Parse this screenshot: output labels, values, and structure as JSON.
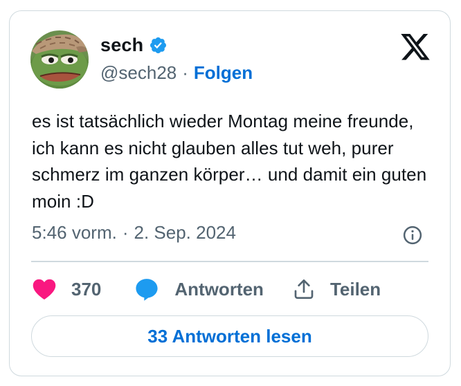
{
  "author": {
    "display_name": "sech",
    "handle": "@sech28",
    "verified": true,
    "avatar": "pepe-frog-with-cap"
  },
  "follow_label": "Folgen",
  "separator": "·",
  "platform_icon": "x-logo-icon",
  "tweet": {
    "text": "es ist tatsächlich wieder Montag meine freunde, ich kann es nicht glauben alles tut weh, purer schmerz im ganzen körper… und damit ein guten moin :D",
    "time": "5:46 vorm.",
    "date": "2. Sep. 2024"
  },
  "actions": {
    "like_count": "370",
    "reply_label": "Antworten",
    "share_label": "Teilen"
  },
  "read_replies_label": "33 Antworten lesen",
  "colors": {
    "accent": "#006fd6",
    "verified": "#1d9bf0",
    "like": "#f91880",
    "secondary_text": "#536471",
    "border": "#cfd9de",
    "text": "#0f1419"
  }
}
